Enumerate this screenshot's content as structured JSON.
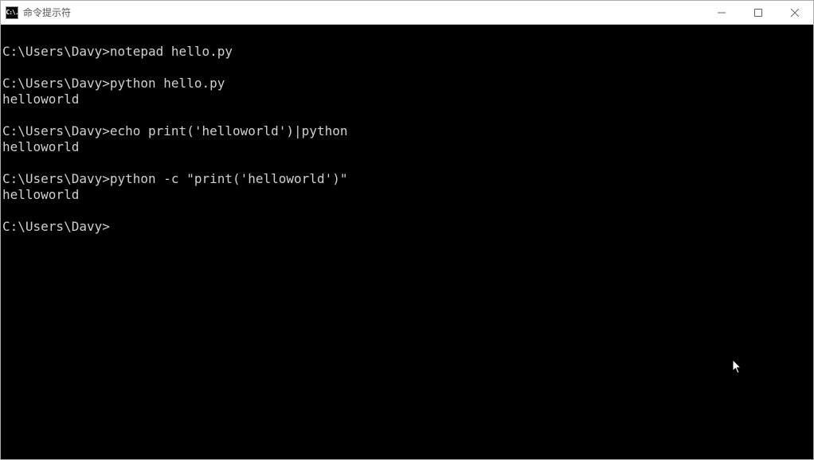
{
  "window": {
    "title": "命令提示符",
    "icon_text": "C:\\."
  },
  "terminal": {
    "prompt": "C:\\Users\\Davy>",
    "blocks": [
      {
        "leading_blank": true,
        "command": "notepad hello.py",
        "output": ""
      },
      {
        "leading_blank": true,
        "command": "python hello.py",
        "output": "helloworld"
      },
      {
        "leading_blank": true,
        "command": "echo print('helloworld')|python",
        "output": "helloworld"
      },
      {
        "leading_blank": true,
        "command": "python -c \"print('helloworld')\"",
        "output": "helloworld"
      },
      {
        "leading_blank": true,
        "command": "",
        "output": ""
      }
    ]
  }
}
